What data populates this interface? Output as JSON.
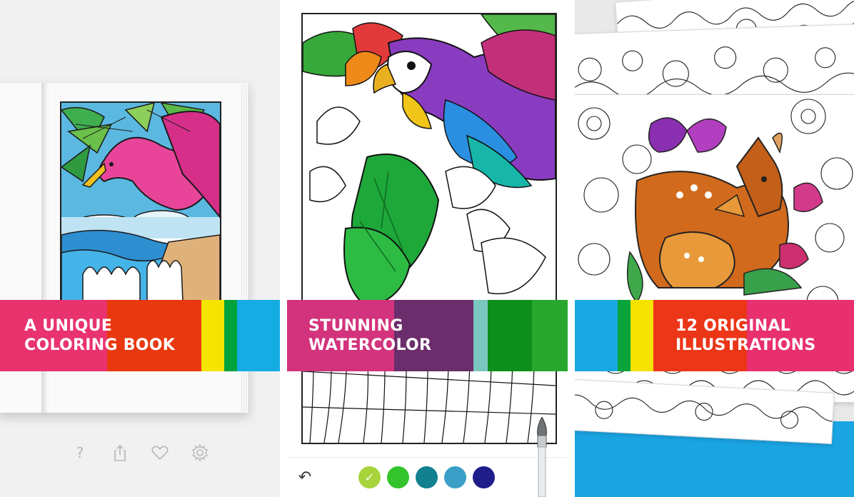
{
  "panels": [
    {
      "banner": {
        "line1": "A UNIQUE",
        "line2": "COLORING BOOK"
      },
      "stripe_colors": [
        "#e8336e",
        "#e8380f",
        "#f5e400",
        "#00a23c",
        "#15ace4"
      ],
      "icons": [
        "help-icon",
        "share-icon",
        "favorite-icon",
        "settings-icon"
      ],
      "help_glyph": "?"
    },
    {
      "banner": {
        "line1": "STUNNING",
        "line2": "WATERCOLOR"
      },
      "stripe_colors": [
        "#d3337c",
        "#6b2d6b",
        "#7ac7c0",
        "#0e8f1c",
        "#27a82d"
      ],
      "toolbar": {
        "undo_glyph": "↶",
        "selected_check": "✓",
        "swatches": [
          "#a7d33b",
          "#33c32a",
          "#12808f",
          "#399fc7",
          "#1e1d8a"
        ]
      }
    },
    {
      "banner": {
        "line1": "12 ORIGINAL",
        "line2": "ILLUSTRATIONS"
      },
      "stripe_colors": [
        "#19a8e2",
        "#09a43a",
        "#f5e200",
        "#ec3618",
        "#e8306e"
      ]
    }
  ]
}
